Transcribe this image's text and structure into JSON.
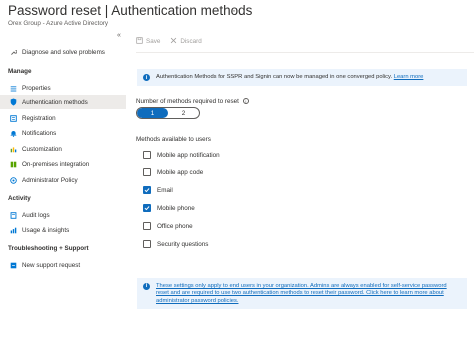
{
  "header": {
    "title": "Password reset | Authentication methods",
    "more": "···",
    "subtitle": "Orex Group - Azure Active Directory"
  },
  "sidebar": {
    "collapse": "«",
    "diagnose": "Diagnose and solve problems",
    "manage_heading": "Manage",
    "manage_items": [
      {
        "label": "Properties",
        "icon": "settings-bars-icon"
      },
      {
        "label": "Authentication methods",
        "icon": "shield-icon",
        "active": true
      },
      {
        "label": "Registration",
        "icon": "registration-icon"
      },
      {
        "label": "Notifications",
        "icon": "bell-icon"
      },
      {
        "label": "Customization",
        "icon": "customization-icon"
      },
      {
        "label": "On-premises integration",
        "icon": "integration-icon"
      },
      {
        "label": "Administrator Policy",
        "icon": "policy-icon"
      }
    ],
    "activity_heading": "Activity",
    "activity_items": [
      {
        "label": "Audit logs",
        "icon": "audit-log-icon"
      },
      {
        "label": "Usage & insights",
        "icon": "insights-icon"
      }
    ],
    "troubleshooting_heading": "Troubleshooting + Support",
    "support_items": [
      {
        "label": "New support request",
        "icon": "support-request-icon"
      }
    ]
  },
  "toolbar": {
    "save_label": "Save",
    "discard_label": "Discard"
  },
  "banner_top": {
    "text": "Authentication Methods for SSPR and Signin can now be managed in one converged policy.",
    "link": "Learn more"
  },
  "methods_required": {
    "label": "Number of methods required to reset",
    "options": [
      "1",
      "2"
    ],
    "selected": "1"
  },
  "methods_available": {
    "label": "Methods available to users",
    "items": [
      {
        "label": "Mobile app notification",
        "checked": false
      },
      {
        "label": "Mobile app code",
        "checked": false
      },
      {
        "label": "Email",
        "checked": true
      },
      {
        "label": "Mobile phone",
        "checked": true
      },
      {
        "label": "Office phone",
        "checked": false
      },
      {
        "label": "Security questions",
        "checked": false
      }
    ]
  },
  "banner_bottom": {
    "text": "These settings only apply to end users in your organization. Admins are always enabled for self-service password reset and are required to use two authentication methods to reset their password. Click here to learn more about administrator password policies."
  },
  "colors": {
    "accent": "#0f6cbd",
    "banner_bg": "#ebf3fc",
    "active_nav_bg": "#edebe9"
  }
}
